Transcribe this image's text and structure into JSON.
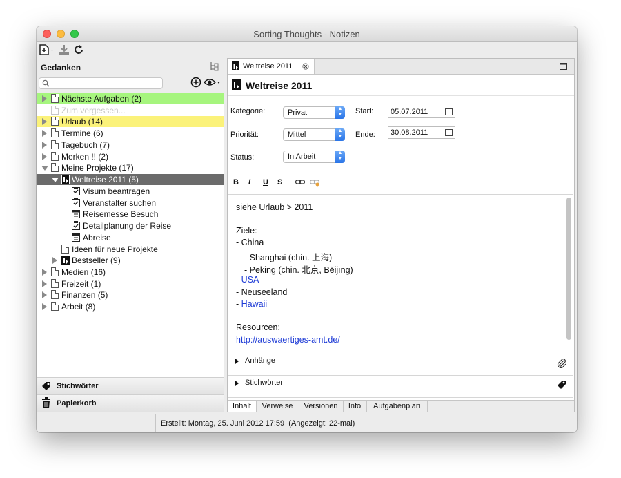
{
  "window": {
    "title": "Sorting Thoughts - Notizen"
  },
  "left_panel": {
    "heading": "Gedanken",
    "search_placeholder": "",
    "tree": [
      {
        "label": "Nächste Aufgaben (2)",
        "highlight": "#a6f57e"
      },
      {
        "label": "Zum vergessen...",
        "faint": true
      },
      {
        "label": "Urlaub (14)",
        "highlight": "#fbf27a"
      },
      {
        "label": "Termine (6)"
      },
      {
        "label": "Tagebuch (7)"
      },
      {
        "label": "Merken !! (2)"
      },
      {
        "label": "Meine Projekte (17)"
      },
      {
        "label": "Weltreise 2011 (5)",
        "selected": true
      },
      {
        "label": "Visum beantragen"
      },
      {
        "label": "Veranstalter suchen"
      },
      {
        "label": "Reisemesse Besuch"
      },
      {
        "label": "Detailplanung der Reise"
      },
      {
        "label": "Abreise"
      },
      {
        "label": "Ideen für neue Projekte"
      },
      {
        "label": "Bestseller (9)"
      },
      {
        "label": "Medien (16)"
      },
      {
        "label": "Freizeit (1)"
      },
      {
        "label": "Finanzen (5)"
      },
      {
        "label": "Arbeit (8)"
      }
    ],
    "keywords_button": "Stichwörter",
    "trash_button": "Papierkorb"
  },
  "editor": {
    "tab_label": "Weltreise 2011",
    "note_title": "Weltreise 2011",
    "fields": {
      "category_label": "Kategorie:",
      "category_value": "Privat",
      "priority_label": "Priorität:",
      "priority_value": "Mittel",
      "status_label": "Status:",
      "status_value": "In Arbeit",
      "start_label": "Start:",
      "start_value": "05.07.2011",
      "end_label": "Ende:",
      "end_value": "30.08.2011"
    },
    "format_buttons": [
      "B",
      "I",
      "U",
      "S"
    ],
    "content": {
      "l1": "siehe Urlaub > 2011",
      "l2": "Ziele:",
      "l3": "- China",
      "l4": "- Shanghai (chin. 上海)",
      "l5": "- Peking (chin. 北京, Běijīng)",
      "l6_dash": "- ",
      "l6_link": "USA",
      "l7": "- Neuseeland",
      "l8_dash": "- ",
      "l8_link": "Hawaii",
      "l9": "Resourcen:",
      "l10_link": "http://auswaertiges-amt.de/"
    },
    "attachments_label": "Anhänge",
    "keywords_label": "Stichwörter",
    "bottom_tabs": [
      "Inhalt",
      "Verweise",
      "Versionen",
      "Info",
      "Aufgabenplan"
    ]
  },
  "status_bar": {
    "text": "Erstellt: Montag, 25. Juni 2012 17:59  (Angezeigt: 22-mal)"
  }
}
